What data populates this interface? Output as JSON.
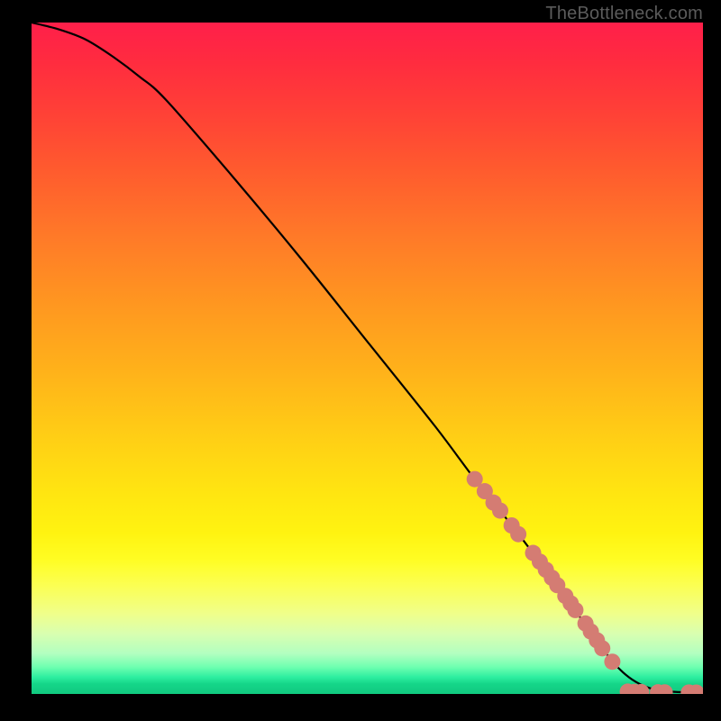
{
  "attribution": "TheBottleneck.com",
  "colors": {
    "background": "#000000",
    "curve": "#000000",
    "marker_fill": "#d47c73",
    "marker_stroke": "#b85a52",
    "gradient_top": "#ff1f4a",
    "gradient_bottom": "#11c97f"
  },
  "chart_data": {
    "type": "line",
    "title": "",
    "xlabel": "",
    "ylabel": "",
    "xlim": [
      0,
      100
    ],
    "ylim": [
      0,
      100
    ],
    "grid": false,
    "legend": false,
    "series": [
      {
        "name": "curve",
        "x": [
          0,
          4,
          8,
          12,
          16,
          20,
          30,
          40,
          50,
          60,
          66,
          72,
          78,
          82,
          86,
          88,
          90,
          92,
          94,
          96,
          98,
          100
        ],
        "y": [
          100,
          99,
          97.5,
          95,
          92,
          88.5,
          77,
          65,
          52.5,
          40,
          32,
          24.5,
          16.5,
          11,
          5.5,
          3.3,
          1.8,
          0.9,
          0.45,
          0.3,
          0.25,
          0.2
        ]
      }
    ],
    "markers": [
      {
        "x": 66.0,
        "y": 32.0
      },
      {
        "x": 67.5,
        "y": 30.2
      },
      {
        "x": 68.8,
        "y": 28.5
      },
      {
        "x": 69.8,
        "y": 27.3
      },
      {
        "x": 71.5,
        "y": 25.1
      },
      {
        "x": 72.5,
        "y": 23.8
      },
      {
        "x": 74.7,
        "y": 21.0
      },
      {
        "x": 75.7,
        "y": 19.7
      },
      {
        "x": 76.6,
        "y": 18.5
      },
      {
        "x": 77.5,
        "y": 17.3
      },
      {
        "x": 78.3,
        "y": 16.2
      },
      {
        "x": 79.5,
        "y": 14.6
      },
      {
        "x": 80.3,
        "y": 13.5
      },
      {
        "x": 81.0,
        "y": 12.5
      },
      {
        "x": 82.5,
        "y": 10.5
      },
      {
        "x": 83.3,
        "y": 9.3
      },
      {
        "x": 84.2,
        "y": 8.0
      },
      {
        "x": 85.0,
        "y": 6.8
      },
      {
        "x": 86.5,
        "y": 4.8
      },
      {
        "x": 88.8,
        "y": 0.35
      },
      {
        "x": 89.8,
        "y": 0.3
      },
      {
        "x": 90.8,
        "y": 0.28
      },
      {
        "x": 93.3,
        "y": 0.25
      },
      {
        "x": 94.3,
        "y": 0.24
      },
      {
        "x": 97.9,
        "y": 0.22
      },
      {
        "x": 99.0,
        "y": 0.21
      }
    ],
    "marker_radius_px": 9
  }
}
